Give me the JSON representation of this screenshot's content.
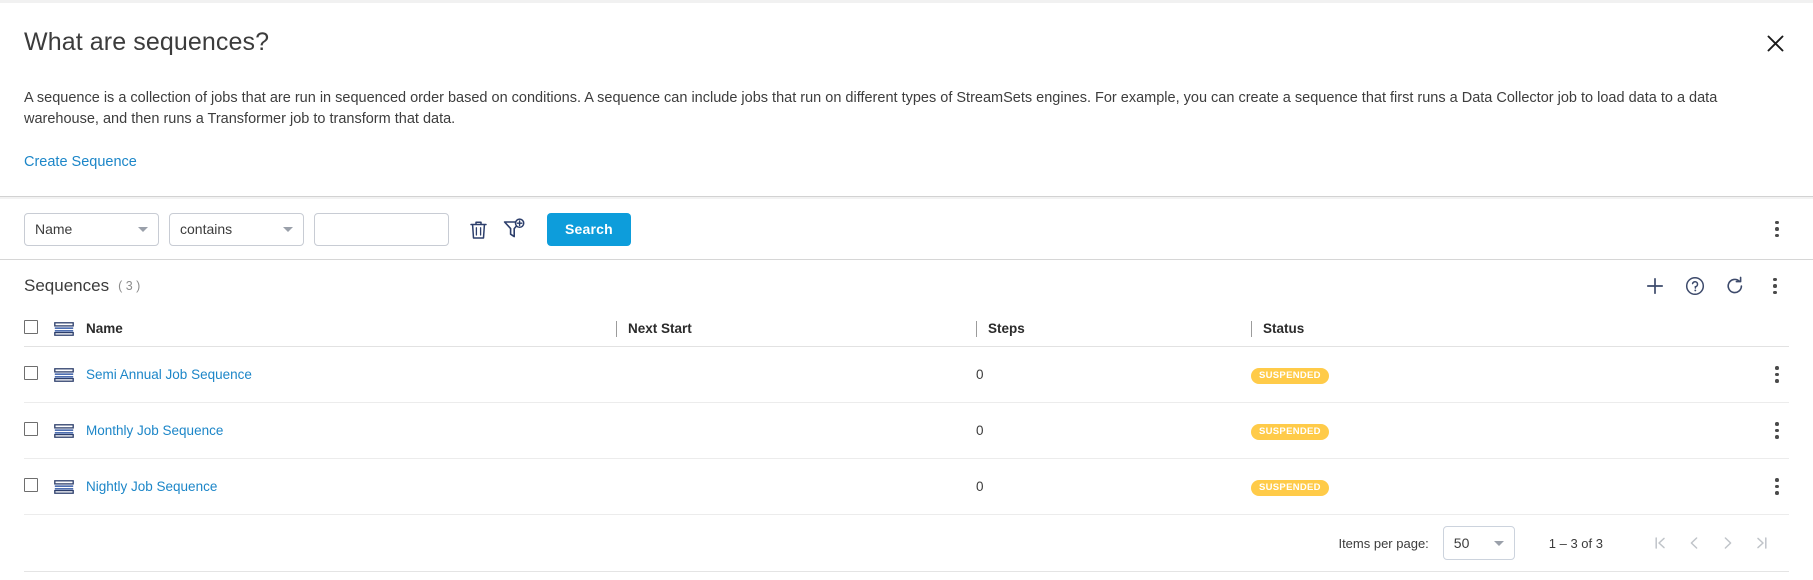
{
  "info_panel": {
    "title": "What are sequences?",
    "description": "A sequence is a collection of jobs that are run in sequenced order based on conditions. A sequence can include jobs that run on different types of StreamSets engines. For example, you can create a sequence that first runs a Data Collector job to load data to a data warehouse, and then runs a Transformer job to transform that data.",
    "link_label": "Create Sequence",
    "close_icon": "close-icon"
  },
  "filter_bar": {
    "field_select": {
      "value": "Name"
    },
    "operator_select": {
      "value": "contains"
    },
    "value_input": {
      "value": "",
      "placeholder": ""
    },
    "delete_icon": "trash-icon",
    "add_filter_icon": "filter-add-icon",
    "search_label": "Search",
    "overflow_icon": "kebab-menu-icon",
    "accent_color": "#0d9ddb"
  },
  "table": {
    "title": "Sequences",
    "count": "( 3 )",
    "tools": [
      {
        "name": "add-sequence-button",
        "icon": "plus-icon"
      },
      {
        "name": "help-button",
        "icon": "help-circle-icon"
      },
      {
        "name": "refresh-button",
        "icon": "refresh-icon"
      },
      {
        "name": "table-overflow-button",
        "icon": "kebab-menu-icon"
      }
    ],
    "columns": [
      {
        "key": "name",
        "label": "Name"
      },
      {
        "key": "next_start",
        "label": "Next Start"
      },
      {
        "key": "steps",
        "label": "Steps"
      },
      {
        "key": "status",
        "label": "Status"
      }
    ],
    "rows": [
      {
        "name": "Semi Annual Job Sequence",
        "next_start": "",
        "steps": "0",
        "status": "SUSPENDED"
      },
      {
        "name": "Monthly Job Sequence",
        "next_start": "",
        "steps": "0",
        "status": "SUSPENDED"
      },
      {
        "name": "Nightly Job Sequence",
        "next_start": "",
        "steps": "0",
        "status": "SUSPENDED"
      }
    ],
    "status_color": "#ffcb49",
    "link_color": "#1c86c8"
  },
  "paginator": {
    "items_per_page_label": "Items per page:",
    "items_per_page_value": "50",
    "range_label": "1 – 3 of 3",
    "first_page_icon": "first-page-icon",
    "prev_page_icon": "prev-page-icon",
    "next_page_icon": "next-page-icon",
    "last_page_icon": "last-page-icon"
  }
}
